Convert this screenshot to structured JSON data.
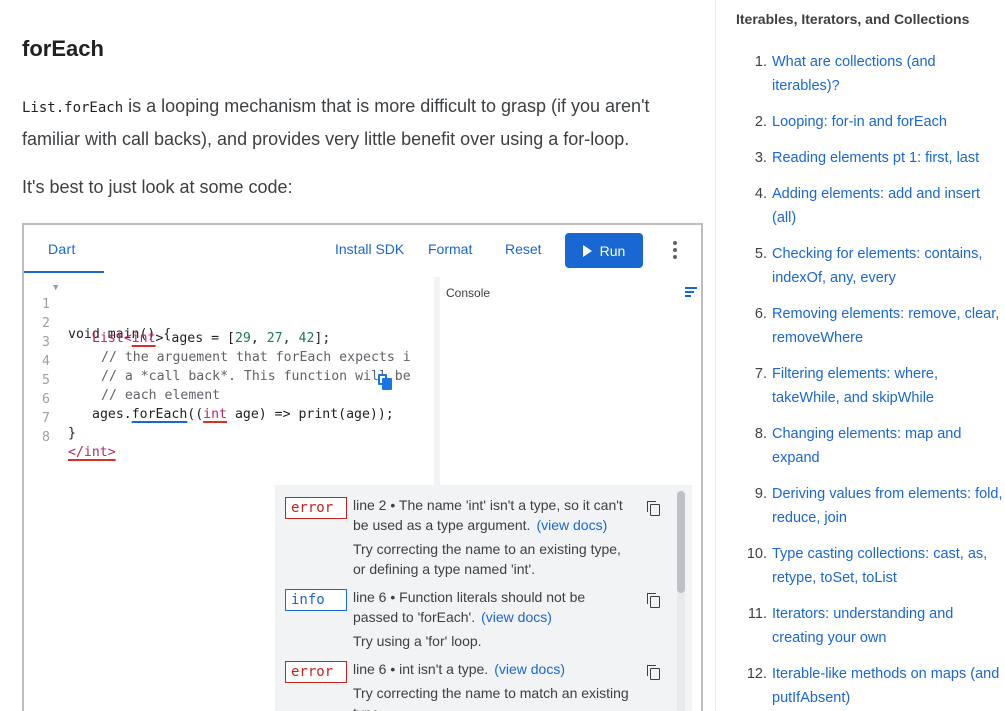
{
  "article": {
    "heading": "forEach",
    "para1_code": "List.forEach",
    "para1_text": " is a looping mechanism that is more difficult to grasp (if you aren't familiar with call backs), and provides very little benefit over using a for-loop.",
    "para2": "It's best to just look at some code:"
  },
  "dartpad": {
    "tab_label": "Dart",
    "toolbar": {
      "install_sdk": "Install SDK",
      "format": "Format",
      "reset": "Reset",
      "run": "Run"
    },
    "console_label": "Console",
    "code": {
      "l1": "void main() {",
      "l2_a": "List<",
      "l2_b": "int",
      "l2_c": "> ages = [",
      "l2_n1": "29",
      "l2_n2": "27",
      "l2_n3": "42",
      "l3": "// the arguement that forEach expects i",
      "l4": "// a *call back*. This function will be",
      "l5": "// each element",
      "l6_a": "ages.",
      "l6_b": "forEach",
      "l6_c": "((",
      "l6_d": "int",
      "l6_e": " age) => print(age));",
      "l7": "}",
      "l8": "</int>"
    },
    "line_numbers": [
      "1",
      "2",
      "3",
      "4",
      "5",
      "6",
      "7",
      "8"
    ],
    "issues": [
      {
        "kind": "error",
        "message": "line 2 • The name 'int' isn't a type, so it can't be used as a type argument.",
        "link": "(view docs)",
        "fix": "Try correcting the name to an existing type, or defining a type named 'int'."
      },
      {
        "kind": "info",
        "message": "line 6 • Function literals should not be passed to 'forEach'.",
        "link": "(view docs)",
        "fix": "Try using a 'for' loop."
      },
      {
        "kind": "error",
        "message": "line 6 • int isn't a type.",
        "link": "(view docs)",
        "fix": "Try correcting the name to match an existing type."
      }
    ]
  },
  "toc": {
    "title": "Iterables, Iterators, and Collections",
    "items": [
      {
        "num": "1.",
        "label": "What are collections (and iterables)?"
      },
      {
        "num": "2.",
        "label": "Looping: for-in and forEach"
      },
      {
        "num": "3.",
        "label": "Reading elements pt 1: first, last"
      },
      {
        "num": "4.",
        "label": "Adding elements: add and insert (all)"
      },
      {
        "num": "5.",
        "label": "Checking for elements: contains, indexOf, any, every"
      },
      {
        "num": "6.",
        "label": "Removing elements: remove, clear, removeWhere"
      },
      {
        "num": "7.",
        "label": "Filtering elements: where, takeWhile, and skipWhile"
      },
      {
        "num": "8.",
        "label": "Changing elements: map and expand"
      },
      {
        "num": "9.",
        "label": "Deriving values from elements: fold, reduce, join"
      },
      {
        "num": "10.",
        "label": "Type casting collections: cast, as, retype, toSet, toList"
      },
      {
        "num": "11.",
        "label": "Iterators: understanding and creating your own"
      },
      {
        "num": "12.",
        "label": "Iterable-like methods on maps (and putIfAbsent)"
      }
    ]
  },
  "colors": {
    "link": "#1967d2",
    "error": "#c5221f",
    "keyword_type": "#b5266c",
    "number": "#1a7a5a"
  }
}
